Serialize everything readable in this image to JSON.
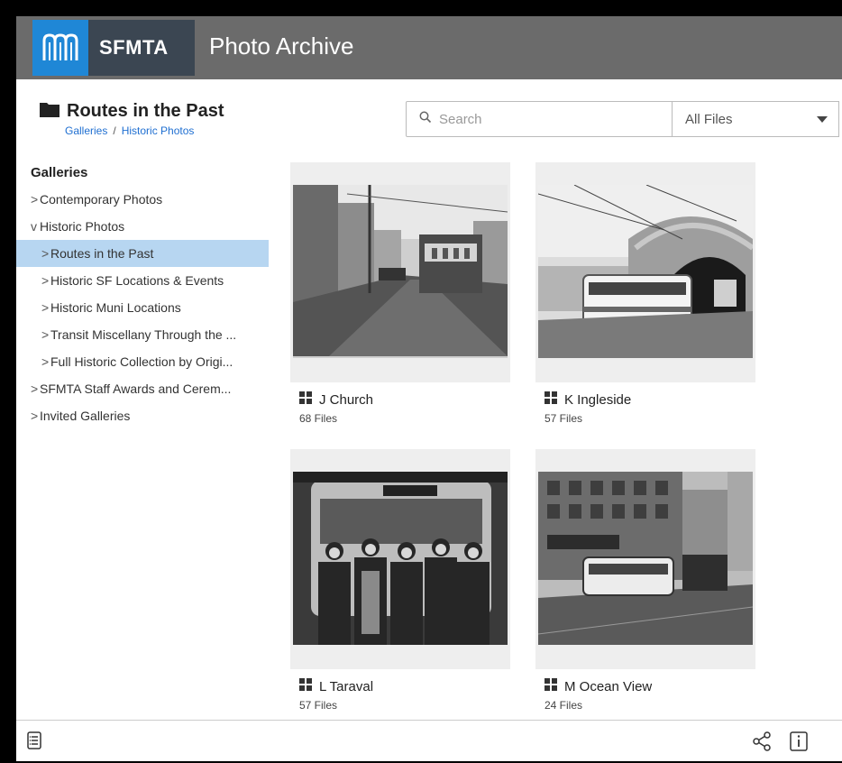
{
  "header": {
    "brand": "SFMTA",
    "app_title": "Photo Archive"
  },
  "folder": {
    "title": "Routes in the Past",
    "breadcrumb": [
      "Galleries",
      "Historic Photos"
    ],
    "breadcrumb_sep": "/"
  },
  "search": {
    "placeholder": "Search",
    "filter_value": "All Files"
  },
  "sidebar": {
    "heading": "Galleries",
    "items": [
      {
        "label": "Contemporary Photos",
        "chevron": ">",
        "active": false
      },
      {
        "label": "Historic Photos",
        "chevron": "v",
        "active": false
      },
      {
        "label": "Routes in the Past",
        "chevron": ">",
        "active": true
      },
      {
        "label": "Historic SF Locations & Events",
        "chevron": ">",
        "active": false
      },
      {
        "label": "Historic Muni Locations",
        "chevron": ">",
        "active": false
      },
      {
        "label": "Transit Miscellany Through the ...",
        "chevron": ">",
        "active": false
      },
      {
        "label": "Full Historic Collection by Origi...",
        "chevron": ">",
        "active": false
      },
      {
        "label": "SFMTA Staff Awards and Cerem...",
        "chevron": ">",
        "active": false
      },
      {
        "label": "Invited Galleries",
        "chevron": ">",
        "active": false
      }
    ]
  },
  "galleries": [
    {
      "title": "J Church",
      "count": "68 Files"
    },
    {
      "title": "K Ingleside",
      "count": "57 Files"
    },
    {
      "title": "L Taraval",
      "count": "57 Files"
    },
    {
      "title": "M Ocean View",
      "count": "24 Files"
    }
  ],
  "colors": {
    "header_bg": "#6b6b6b",
    "brand_blue": "#1f87d6",
    "brand_dark": "#3b4652",
    "active_bg": "#b7d6f1",
    "link": "#1f6fd1"
  },
  "icons": {
    "folder": "folder-icon",
    "search": "search-icon",
    "dropdown": "caret-down-icon",
    "gallery": "grid-icon",
    "details": "list-icon",
    "share": "share-icon",
    "info": "info-icon"
  }
}
